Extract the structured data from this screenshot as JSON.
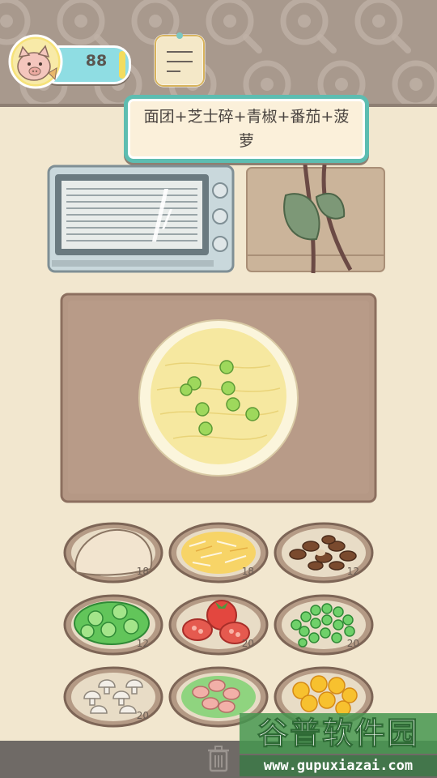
{
  "hud": {
    "score": "88",
    "avatar_icon": "pig-chef-icon",
    "note_icon": "notepad-icon"
  },
  "recipe": {
    "line1": "面团+芝士碎+青椒+番茄+菠",
    "line2": "萝"
  },
  "stations": {
    "oven_icon": "oven-icon",
    "box_icon": "gift-box-icon",
    "board_icon": "cutting-board-icon",
    "pizza": "pizza-in-progress"
  },
  "ingredients": [
    {
      "name": "dough",
      "count": "18"
    },
    {
      "name": "cheese",
      "count": "18"
    },
    {
      "name": "mushroom-brown",
      "count": "12"
    },
    {
      "name": "green-pepper",
      "count": "12"
    },
    {
      "name": "tomato",
      "count": "20"
    },
    {
      "name": "peas",
      "count": "20"
    },
    {
      "name": "mushroom-white",
      "count": "20"
    },
    {
      "name": "shrimp",
      "count": ""
    },
    {
      "name": "pineapple",
      "count": ""
    }
  ],
  "toolbar": {
    "trash_icon": "trash-icon"
  },
  "watermark": {
    "main": "谷普软件园",
    "url": "www.gupuxiazai.com"
  },
  "colors": {
    "wall": "#a8998d",
    "counter": "#f2e7cf",
    "card_border": "#5dbdb1",
    "score_pill": "#8fdde3",
    "board": "#b59885"
  }
}
